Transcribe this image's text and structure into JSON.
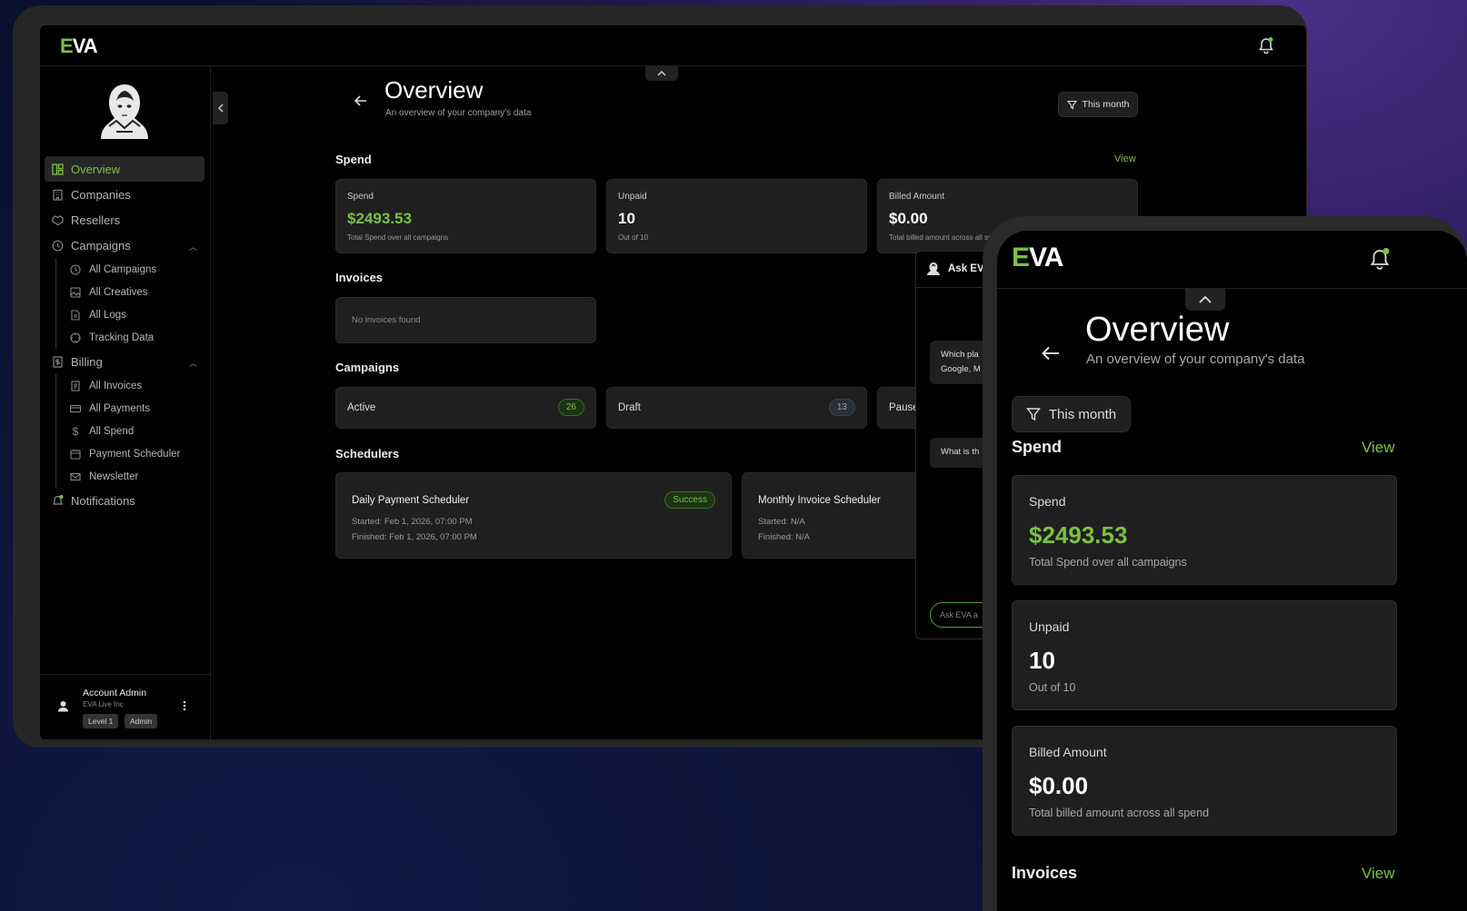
{
  "brand": {
    "logo_prefix": "E",
    "logo_rest": "VA",
    "accent": "#7ac142"
  },
  "sidebar": {
    "items": [
      {
        "label": "Overview",
        "icon": "layout-icon",
        "active": true
      },
      {
        "label": "Companies",
        "icon": "building-icon"
      },
      {
        "label": "Resellers",
        "icon": "handshake-icon"
      },
      {
        "label": "Campaigns",
        "icon": "clock-icon"
      }
    ],
    "campaigns_sub": [
      "All Campaigns",
      "All Creatives",
      "All Logs",
      "Tracking Data"
    ],
    "billing_label": "Billing",
    "billing_sub": [
      "All Invoices",
      "All Payments",
      "All Spend",
      "Payment Scheduler",
      "Newsletter"
    ],
    "notifications_label": "Notifications"
  },
  "account": {
    "name": "Account Admin",
    "company": "EVA Live Inc",
    "tags": [
      "Level 1",
      "Admin"
    ]
  },
  "header": {
    "title": "Overview",
    "subtitle": "An overview of your company's data",
    "filter_label": "This month"
  },
  "spend": {
    "title": "Spend",
    "view_label": "View",
    "cards": [
      {
        "label": "Spend",
        "value": "$2493.53",
        "sub": "Total Spend over all campaigns"
      },
      {
        "label": "Unpaid",
        "value": "10",
        "sub": "Out of 10"
      },
      {
        "label": "Billed Amount",
        "value": "$0.00",
        "sub": "Total billed amount across all spend"
      }
    ]
  },
  "invoices": {
    "title": "Invoices",
    "empty": "No invoices found",
    "view_label": "View"
  },
  "campaigns": {
    "title": "Campaigns",
    "items": [
      {
        "label": "Active",
        "count": "26"
      },
      {
        "label": "Draft",
        "count": "13"
      },
      {
        "label": "Paused"
      }
    ]
  },
  "schedulers": {
    "title": "Schedulers",
    "items": [
      {
        "name": "Daily Payment Scheduler",
        "status": "Success",
        "started": "Started: Feb 1, 2026, 07:00 PM",
        "finished": "Finished: Feb 1, 2026, 07:00 PM"
      },
      {
        "name": "Monthly Invoice Scheduler",
        "started": "Started: N/A",
        "finished": "Finished: N/A"
      }
    ]
  },
  "chat": {
    "title": "Ask EV",
    "msg1_line1": "Which pla",
    "msg1_line2": "Google, M",
    "msg2": "What is th",
    "input_placeholder": "Ask EVA a"
  }
}
